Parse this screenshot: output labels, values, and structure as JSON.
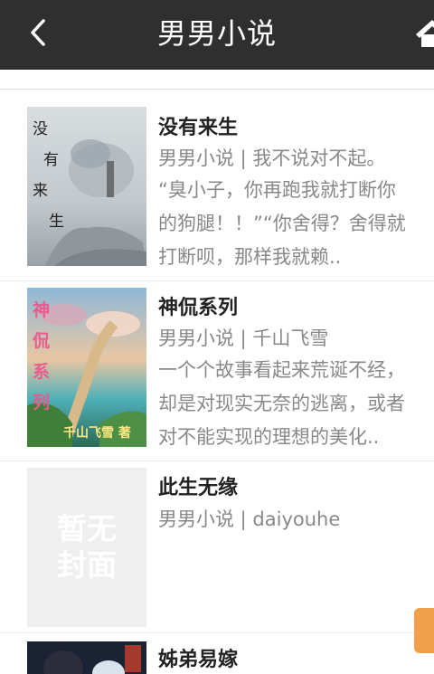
{
  "header": {
    "title": "男男小说",
    "back_icon": "chevron-left-icon",
    "home_icon": "home-icon"
  },
  "books": [
    {
      "title": "没有来生",
      "meta": "男男小说 | 我不说对不起。",
      "desc_lines": [
        "“臭小子，你再跑我就打断你",
        "的狗腿！！”“你舍得？舍得就",
        "打断呗，那样我就赖.."
      ],
      "cover_text": [
        "没",
        "有",
        "来",
        "生"
      ]
    },
    {
      "title": "神侃系列",
      "meta": "男男小说 | 千山飞雪",
      "desc_lines": [
        "一个个故事看起来荒诞不经，",
        "却是对现实无奈的逃离，或者",
        "对不能实现的理想的美化.."
      ],
      "cover_text": [
        "神",
        "侃",
        "系",
        "列"
      ],
      "cover_signature": "千山飞雪 著"
    },
    {
      "title": "此生无缘",
      "meta": "男男小说 | daiyouhe",
      "desc_lines": [],
      "cover_text": [
        "暂无",
        "封面"
      ]
    },
    {
      "title": "姊弟易嫁",
      "meta": "",
      "desc_lines": []
    }
  ],
  "colors": {
    "header_bg": "#2f2f2f",
    "float_tab": "#f0a04b"
  }
}
